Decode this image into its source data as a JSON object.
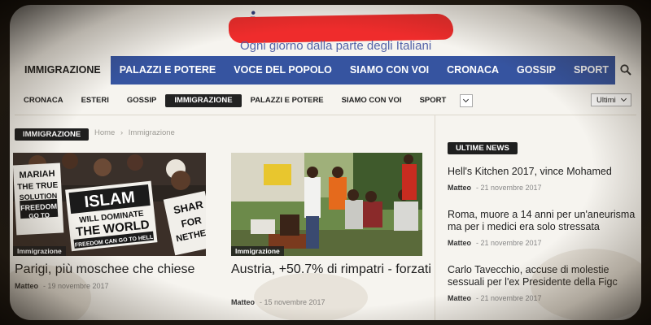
{
  "header": {
    "logo_text": "i",
    "tagline": "Ogni giorno dalla parte degli Italiani"
  },
  "main_nav": {
    "items": [
      "IMMIGRAZIONE",
      "PALAZZI E POTERE",
      "VOCE DEL POPOLO",
      "SIAMO CON VOI",
      "CRONACA",
      "GOSSIP",
      "SPORT"
    ],
    "active_index": 0,
    "search_icon": "search-icon"
  },
  "sub_nav": {
    "items": [
      "CRONACA",
      "ESTERI",
      "GOSSIP",
      "IMMIGRAZIONE",
      "PALAZZI E POTERE",
      "SIAMO CON VOI",
      "SPORT"
    ],
    "active_index": 3,
    "more_icon": "chevron-down-icon",
    "sort_select": "Ultimi"
  },
  "section": {
    "badge": "IMMIGRAZIONE",
    "breadcrumb": {
      "home": "Home",
      "sep": "›",
      "current": "Immigrazione"
    }
  },
  "articles": [
    {
      "category": "Immigrazione",
      "title": "Parigi, più moschee che chiese",
      "author": "Matteo",
      "date": "19 novembre 2017",
      "sign_texts": [
        "MARIAH",
        "THE TRUE",
        "SOLUTION",
        "FREEDOM",
        "GO TO",
        "ISLAM",
        "WILL DOMINATE",
        "THE WORLD",
        "FREEDOM CAN GO TO HELL",
        "SHAR",
        "FOR",
        "NETHER"
      ]
    },
    {
      "category": "Immigrazione",
      "title": "Austria, +50.7% di rimpatri - forzati",
      "author": "Matteo",
      "date": "15 novembre 2017"
    }
  ],
  "sidebar": {
    "badge": "ULTIME NEWS",
    "items": [
      {
        "title": "Hell's Kitchen 2017, vince Mohamed",
        "author": "Matteo",
        "date": "21 novembre 2017"
      },
      {
        "title": "Roma, muore a 14 anni per un'aneurisma ma per i medici era solo stressata",
        "author": "Matteo",
        "date": "21 novembre 2017"
      },
      {
        "title": "Carlo Tavecchio, accuse di molestie sessuali per l'ex Presidente della Figc",
        "author": "Matteo",
        "date": "21 novembre 2017"
      }
    ]
  },
  "colors": {
    "nav_blue": "#3654a0",
    "logo_blue": "#2e3a7c",
    "redaction_red": "#ef2c2c",
    "badge_dark": "#1f1f1f"
  }
}
